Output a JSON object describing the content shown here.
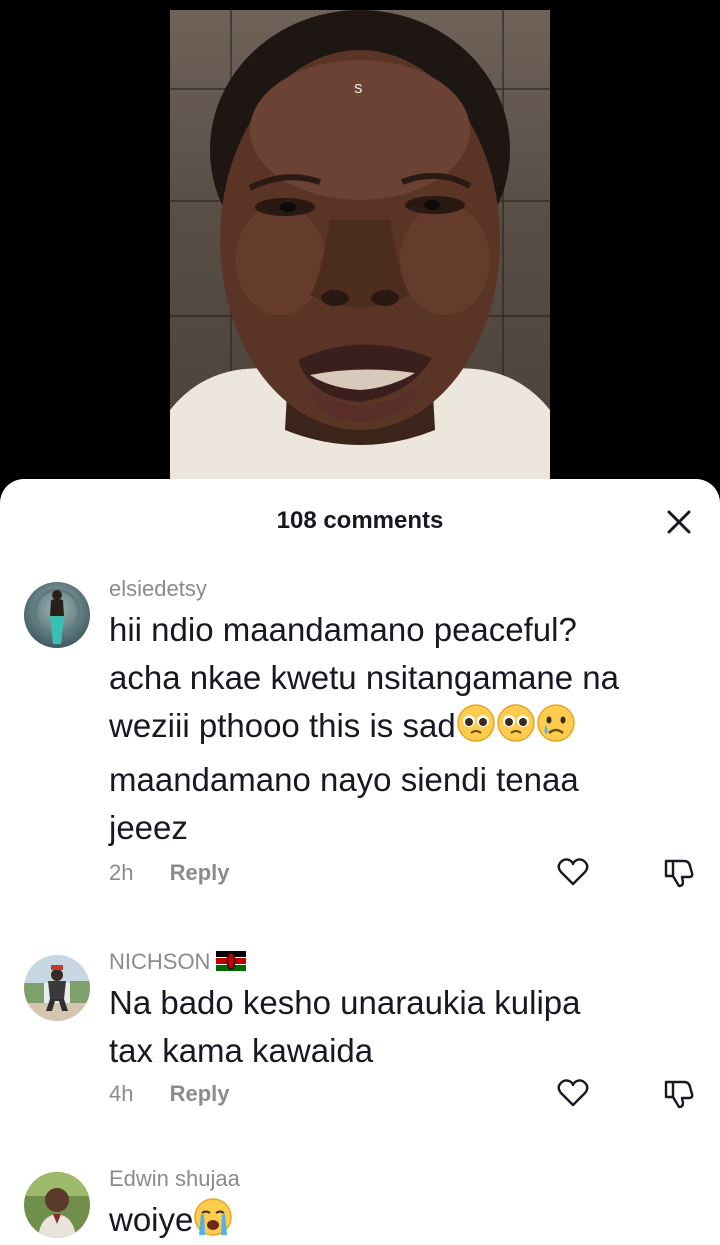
{
  "video": {
    "watermark": "s"
  },
  "sheet": {
    "title": "108 comments",
    "close_icon": "close-icon"
  },
  "comments": [
    {
      "username": "elsiedetsy",
      "lines": [
        "hii ndio maandamano peaceful?",
        "acha nkae kwetu nsitangamane na",
        "weziii pthooo this is sad",
        "maandamano nayo siendi tenaa",
        "jeeez"
      ],
      "emojis": [
        "pleading-face-emoji",
        "pleading-face-emoji",
        "crying-face-emoji"
      ],
      "time": "2h",
      "reply_label": "Reply"
    },
    {
      "username": "NICHSON",
      "badge": "kenya-flag-icon",
      "lines": [
        "Na bado kesho unaraukia kulipa",
        "tax kama kawaida"
      ],
      "time": "4h",
      "reply_label": "Reply"
    },
    {
      "username": "Edwin shujaa",
      "lines": [
        "woiye"
      ],
      "emojis": [
        "loudly-crying-face-emoji"
      ]
    }
  ],
  "colors": {
    "text_primary": "#161823",
    "text_secondary": "#8a8b91",
    "sheet_bg": "#ffffff",
    "screen_bg": "#000000"
  }
}
